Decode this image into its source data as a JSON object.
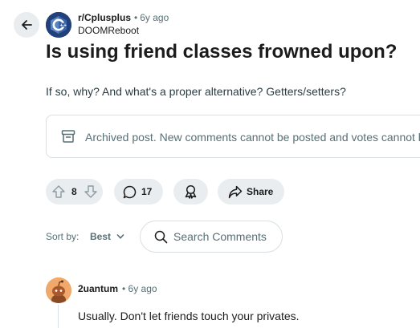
{
  "header": {
    "back_icon": "arrow-left-icon",
    "subreddit": "r/Cplusplus",
    "separator": "•",
    "time": "6y ago",
    "author": "DOOMReboot",
    "subreddit_avatar_icon": "cplusplus-logo-icon"
  },
  "post": {
    "title": "Is using friend classes frowned upon?",
    "body": "If so, why? And what's a proper alternative? Getters/setters?",
    "archived_notice": "Archived post. New comments cannot be posted and votes cannot be cast.",
    "archived_icon": "archive-box-icon"
  },
  "actions": {
    "vote_count": "8",
    "upvote_icon": "arrow-up-icon",
    "downvote_icon": "arrow-down-icon",
    "comment_count": "17",
    "comment_icon": "speech-bubble-icon",
    "award_icon": "award-ribbon-icon",
    "share_label": "Share",
    "share_icon": "share-arrow-icon"
  },
  "comments_toolbar": {
    "sort_label": "Sort by:",
    "sort_value": "Best",
    "search_placeholder": "Search Comments"
  },
  "comments": [
    {
      "author": "2uantum",
      "separator": "•",
      "time": "6y ago",
      "body": "Usually. Don't let friends touch your privates."
    }
  ],
  "colors": {
    "pill_bg": "#eaedef",
    "border": "#d9dfe2",
    "muted_text": "#576f76",
    "text": "#1c1c1c"
  }
}
